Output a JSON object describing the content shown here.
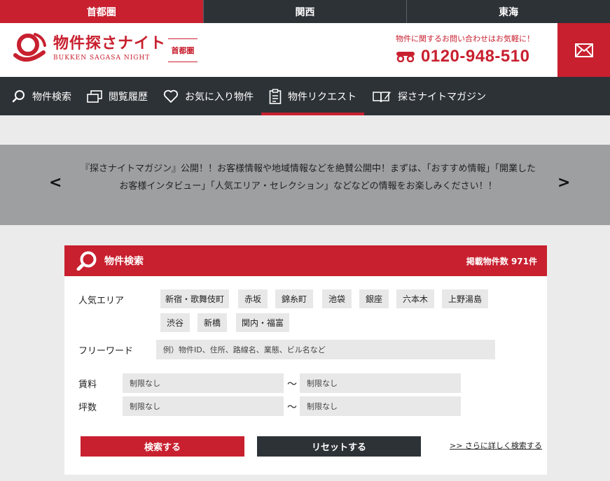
{
  "regions": [
    {
      "label": "首都圏",
      "active": true
    },
    {
      "label": "関西",
      "active": false
    },
    {
      "label": "東海",
      "active": false
    }
  ],
  "header": {
    "logo_title": "物件探さナイト",
    "logo_subtitle": "BUKKEN SAGASA NIGHT",
    "area_label": "首都圏",
    "contact_note": "物件に関するお問い合わせはお気軽に！",
    "phone_number": "0120-948-510",
    "brand_color": "#c8202f"
  },
  "nav": [
    {
      "label": "物件検索",
      "icon": "search-icon"
    },
    {
      "label": "閲覧履歴",
      "icon": "history-icon"
    },
    {
      "label": "お気に入り物件",
      "icon": "heart-icon"
    },
    {
      "label": "物件リクエスト",
      "icon": "clipboard-icon",
      "active": true
    },
    {
      "label": "探さナイトマガジン",
      "icon": "book-icon"
    }
  ],
  "notice": {
    "text": "『探さナイトマガジン』公開！！お客様情報や地域情報などを絶賛公開中！まずは、「おすすめ情報」「開業したお客様インタビュー」「人気エリア・セレクション」などなどの情報をお楽しみください！！",
    "prev": "<",
    "next": ">"
  },
  "search": {
    "title": "物件検索",
    "count_label": "掲載物件数 971件",
    "popular_area_label": "人気エリア",
    "areas": [
      "新宿・歌舞伎町",
      "赤坂",
      "錦糸町",
      "池袋",
      "銀座",
      "六本木",
      "上野湯島",
      "渋谷",
      "新橋",
      "関内・福富"
    ],
    "freeword_label": "フリーワード",
    "freeword_placeholder": "例）物件ID、住所、路線名、業態、ビル名など",
    "rent_label": "賃料",
    "area_size_label": "坪数",
    "range_separator": "〜",
    "rent_min": "制限なし",
    "rent_max": "制限なし",
    "size_min": "制限なし",
    "size_max": "制限なし",
    "search_button": "検索する",
    "reset_button": "リセットする",
    "advanced_link": ">> さらに詳しく検索する"
  }
}
